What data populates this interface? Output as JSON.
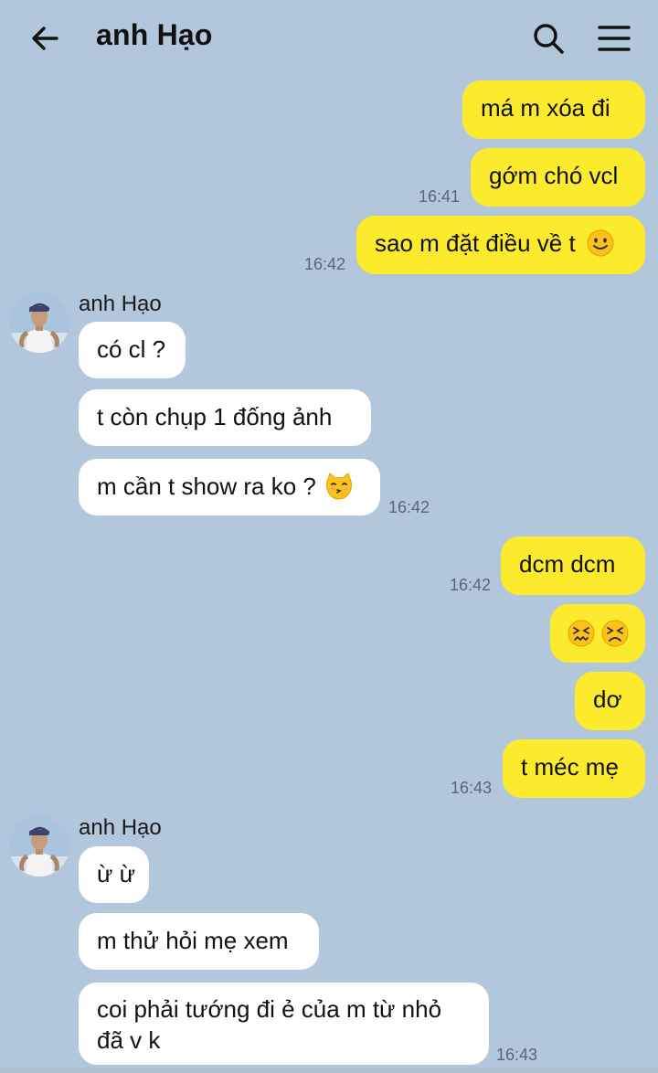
{
  "header": {
    "title": "anh Hạo",
    "back_icon": "arrow-left-icon",
    "search_icon": "search-icon",
    "menu_icon": "hamburger-menu-icon"
  },
  "colors": {
    "background": "#b3c7dc",
    "outgoing_bubble": "#fcea2c",
    "incoming_bubble": "#ffffff"
  },
  "messages": {
    "m1": {
      "text": "má m xóa đi"
    },
    "m2": {
      "text": "gớm chó vcl",
      "time": "16:41"
    },
    "m3": {
      "text": "sao m đặt điều về t",
      "emoji": "smiling-face-emoji",
      "time": "16:42"
    },
    "g1_sender": "anh Hạo",
    "m4": {
      "text": "có cl ?"
    },
    "m5": {
      "text": "t còn chụp 1 đống ảnh"
    },
    "m6": {
      "text": "m cần t show ra ko ?",
      "emoji": "kissing-cat-emoji",
      "time": "16:42"
    },
    "m7": {
      "text": "dcm dcm",
      "time": "16:42"
    },
    "m8": {
      "emoji": "confounded-face-emoji x2"
    },
    "m9": {
      "text": "dơ"
    },
    "m10": {
      "text": "t méc mẹ",
      "time": "16:43"
    },
    "g2_sender": "anh Hạo",
    "m11": {
      "text": "ừ ừ"
    },
    "m12": {
      "text": "m thử hỏi mẹ xem"
    },
    "m13": {
      "line1": "coi phải tướng đi ẻ của m từ nhỏ",
      "line2": "đã v k",
      "time": "16:43"
    }
  }
}
